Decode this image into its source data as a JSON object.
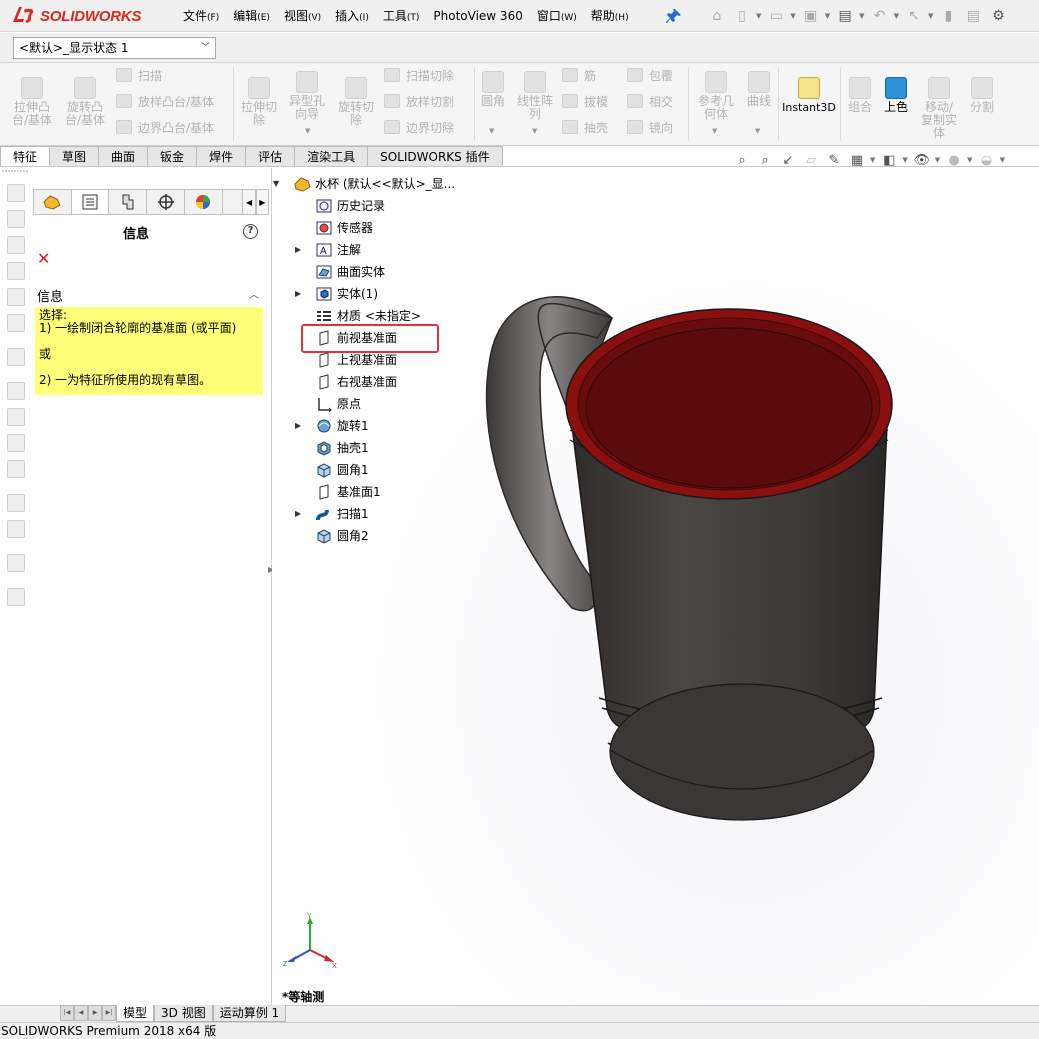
{
  "app": {
    "brand": "SOLIDWORKS",
    "status": "SOLIDWORKS Premium 2018 x64 版"
  },
  "menu": [
    {
      "label": "文件",
      "acc": "(F)"
    },
    {
      "label": "编辑",
      "acc": "(E)"
    },
    {
      "label": "视图",
      "acc": "(V)"
    },
    {
      "label": "插入",
      "acc": "(I)"
    },
    {
      "label": "工具",
      "acc": "(T)"
    },
    {
      "label": "PhotoView 360",
      "acc": ""
    },
    {
      "label": "窗口",
      "acc": "(W)"
    },
    {
      "label": "帮助",
      "acc": "(H)"
    }
  ],
  "config_dropdown": "<默认>_显示状态 1",
  "ribbon": {
    "extrude_boss": "拉伸凸\n台/基体",
    "revolve_boss": "旋转凸\n台/基体",
    "sweep": "扫描",
    "loft": "放样凸台/基体",
    "boundary": "边界凸台/基体",
    "extrude_cut": "拉伸切\n除",
    "hole_wizard": "异型孔\n向导",
    "revolve_cut": "旋转切\n除",
    "swept_cut": "扫描切除",
    "lofted_cut": "放样切割",
    "boundary_cut": "边界切除",
    "fillet": "圆角",
    "linear_pattern": "线性阵\n列",
    "rib": "筋",
    "draft": "拔模",
    "shell": "抽壳",
    "wrap": "包覆",
    "intersect": "相交",
    "mirror": "镜向",
    "ref_geometry": "参考几\n何体",
    "curves": "曲线",
    "instant3d": "Instant3D",
    "combine": "组合",
    "appearance": "上色",
    "move_copy": "移动/\n复制实\n体",
    "split": "分割"
  },
  "tabs": [
    "特征",
    "草图",
    "曲面",
    "钣金",
    "焊件",
    "评估",
    "渲染工具",
    "SOLIDWORKS 插件"
  ],
  "panel": {
    "title": "信息",
    "section": "信息",
    "lines": [
      "选择:",
      "1) 一绘制闭合轮廓的基准面 (或平面)",
      "或",
      "2) 一为特征所使用的现有草图。"
    ]
  },
  "tree": {
    "root": "水杯  (默认<<默认>_显...",
    "nodes": [
      {
        "label": "历史记录",
        "icon": "history-icon",
        "expand": false
      },
      {
        "label": "传感器",
        "icon": "sensor-icon",
        "expand": false
      },
      {
        "label": "注解",
        "icon": "annotation-icon",
        "expand": true
      },
      {
        "label": "曲面实体",
        "icon": "surface-body-icon",
        "expand": false
      },
      {
        "label": "实体(1)",
        "icon": "solid-body-icon",
        "expand": true
      },
      {
        "label": "材质 <未指定>",
        "icon": "material-icon",
        "expand": false
      },
      {
        "label": "前视基准面",
        "icon": "plane-icon",
        "expand": false
      },
      {
        "label": "上视基准面",
        "icon": "plane-icon",
        "expand": false
      },
      {
        "label": "右视基准面",
        "icon": "plane-icon",
        "expand": false
      },
      {
        "label": "原点",
        "icon": "origin-icon",
        "expand": false
      },
      {
        "label": "旋转1",
        "icon": "revolve-icon",
        "expand": true
      },
      {
        "label": "抽壳1",
        "icon": "shell-icon",
        "expand": false
      },
      {
        "label": "圆角1",
        "icon": "fillet-icon",
        "expand": false
      },
      {
        "label": "基准面1",
        "icon": "plane-icon",
        "expand": false
      },
      {
        "label": "扫描1",
        "icon": "sweep-icon",
        "expand": true
      },
      {
        "label": "圆角2",
        "icon": "fillet-icon",
        "expand": false
      }
    ]
  },
  "viewport": {
    "view_name": "*等轴测",
    "triad": {
      "x": "X",
      "y": "Y",
      "z": "Z"
    }
  },
  "bottom_tabs": [
    "模型",
    "3D 视图",
    "运动算例 1"
  ],
  "colors": {
    "accent": "#da291c",
    "highlight": "#e0343b",
    "info_bg": "#ffff7a",
    "mug_body": "#3f3b39",
    "mug_rim": "#8a1010"
  }
}
